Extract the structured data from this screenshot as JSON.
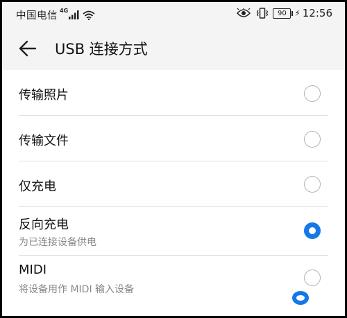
{
  "status": {
    "carrier": "中国电信",
    "network_type": "4G",
    "battery": "90",
    "time": "12:56",
    "icons": [
      "signal-icon",
      "wifi-icon",
      "eye-icon",
      "vibrate-icon",
      "battery-icon",
      "charging-icon"
    ]
  },
  "header": {
    "title": "USB 连接方式",
    "back_icon": "back-arrow-icon"
  },
  "options": [
    {
      "label": "传输照片",
      "sublabel": "",
      "selected": false
    },
    {
      "label": "传输文件",
      "sublabel": "",
      "selected": false
    },
    {
      "label": "仅充电",
      "sublabel": "",
      "selected": false
    },
    {
      "label": "反向充电",
      "sublabel": "为已连接设备供电",
      "selected": true
    },
    {
      "label": "MIDI",
      "sublabel": "将设备用作 MIDI 输入设备",
      "selected": false
    }
  ],
  "colors": {
    "accent": "#1478e6",
    "background": "#f4f4f4",
    "list_background": "#ffffff",
    "divider": "#dddddd",
    "secondary_text": "#888888"
  }
}
